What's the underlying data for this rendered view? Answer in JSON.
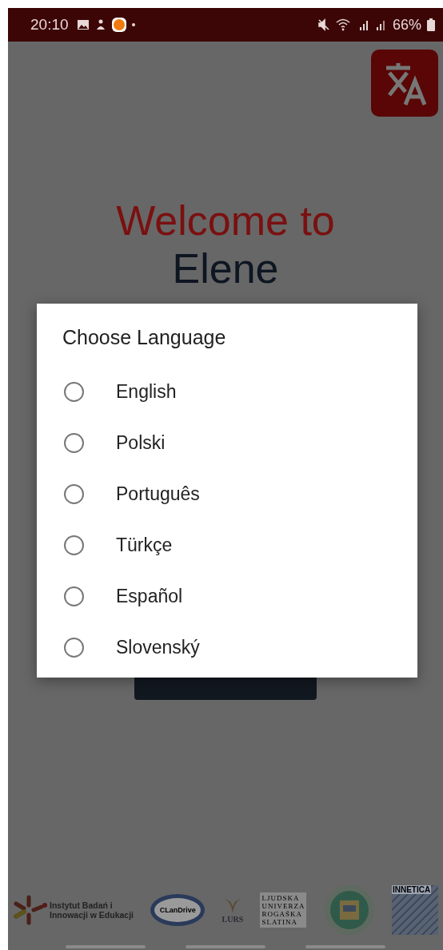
{
  "status_bar": {
    "time": "20:10",
    "battery": "66%"
  },
  "welcome": {
    "line_1": "Welcome to",
    "line_2": "Elene"
  },
  "dialog": {
    "title": "Choose Language",
    "options": [
      {
        "label": "English",
        "selected": false
      },
      {
        "label": "Polski",
        "selected": false
      },
      {
        "label": "Português",
        "selected": false
      },
      {
        "label": "Türkçe",
        "selected": false
      },
      {
        "label": "Español",
        "selected": false
      },
      {
        "label": "Slovenský",
        "selected": false
      }
    ]
  },
  "partners": [
    {
      "kind": "ibe",
      "lines": [
        "Instytut Badań i",
        "Innowacji w Edukacji"
      ]
    },
    {
      "kind": "ring",
      "lines": [
        "CLanDrive"
      ]
    },
    {
      "kind": "lurs",
      "lines": [
        "LURS"
      ]
    },
    {
      "kind": "spaced",
      "lines": [
        "LJUDSKA",
        "UNIVERZA",
        "ROGAŠKA",
        "SLATINA"
      ]
    },
    {
      "kind": "seal"
    },
    {
      "kind": "innetica",
      "lines": [
        "INNETICA"
      ]
    }
  ]
}
